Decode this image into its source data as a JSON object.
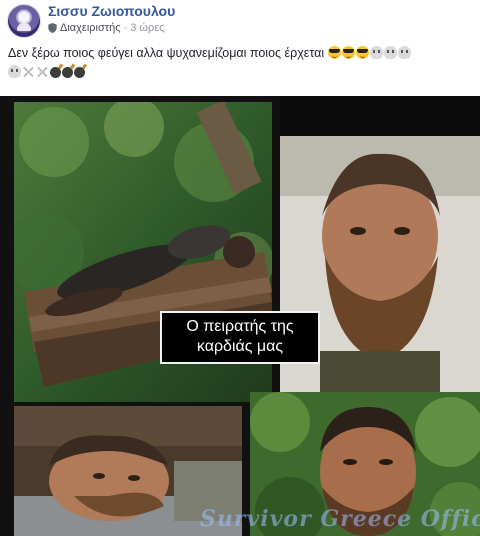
{
  "post": {
    "author": "Σισσυ Ζωιοπουλου",
    "role": "Διαχειριστής",
    "separator": "·",
    "time": "3 ώρες",
    "text": "Δεν ξέρω ποιος φεύγει αλλα ψυχανεμίζομαι ποιος έρχεται",
    "emojis": [
      "smiling-face-with-sunglasses",
      "smiling-face-with-sunglasses",
      "smiling-face-with-sunglasses",
      "skull",
      "skull",
      "skull",
      "skull-and-crossbones",
      "skull-and-crossbones",
      "bomb",
      "bomb",
      "bomb"
    ]
  },
  "image": {
    "caption_line1": "Ο πειρατής της",
    "caption_line2": "καρδιάς μας",
    "watermark": "Survivor Greece Official Fans"
  },
  "colors": {
    "author": "#365899",
    "meta": "#606770",
    "text": "#1d2129",
    "collage_bg": "#111111",
    "caption_bg": "#000000"
  }
}
